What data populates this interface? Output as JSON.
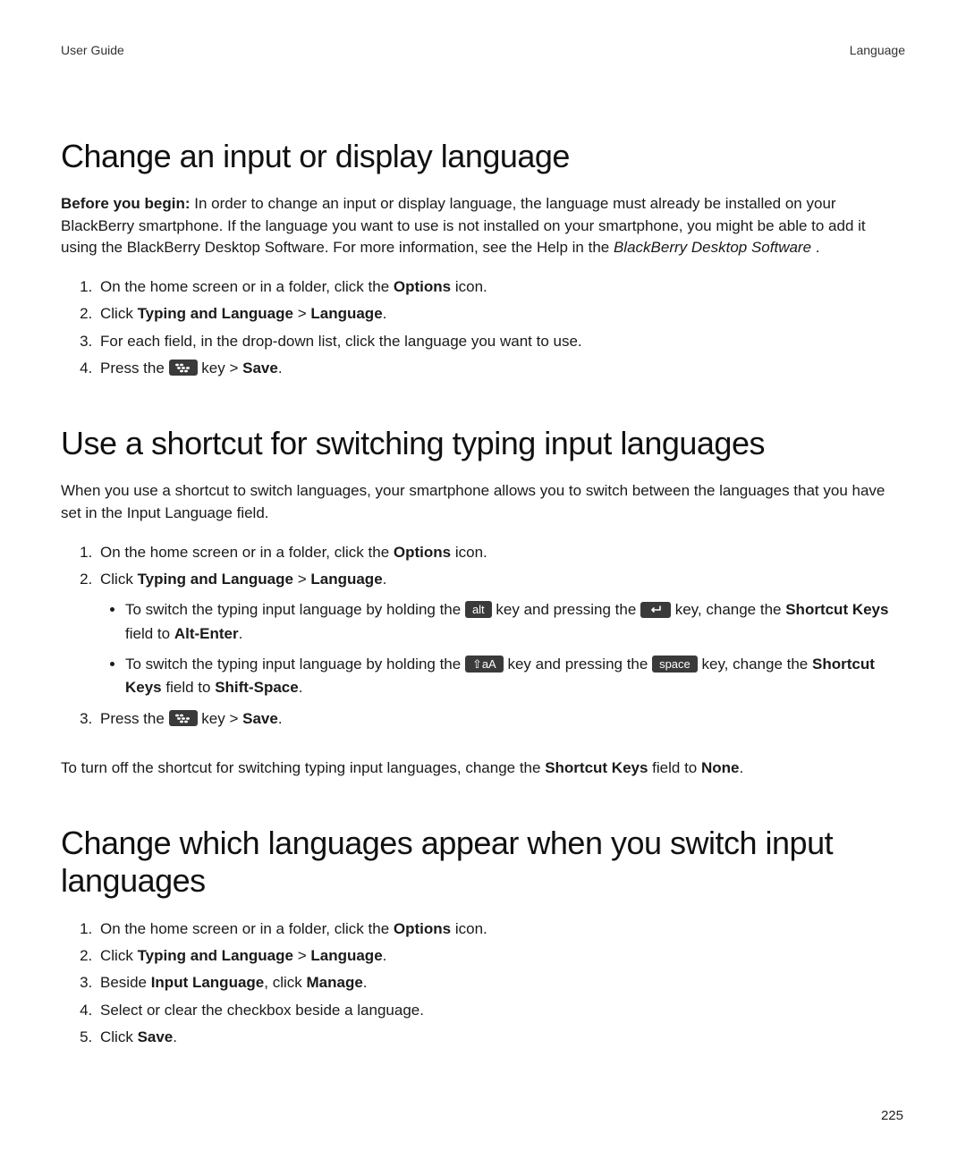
{
  "header": {
    "left": "User Guide",
    "right": "Language"
  },
  "page_number": "225",
  "section1": {
    "title": "Change an input or display language",
    "intro_bold": "Before you begin:",
    "intro_rest": " In order to change an input or display language, the language must already be installed on your BlackBerry smartphone. If the language you want to use is not installed on your smartphone, you might be able to add it using the BlackBerry Desktop Software. For more information, see the Help in the ",
    "intro_italic": "BlackBerry Desktop Software",
    "intro_end": " .",
    "step1_a": "On the home screen or in a folder, click the ",
    "step1_b": "Options",
    "step1_c": " icon.",
    "step2_a": "Click ",
    "step2_b": "Typing and Language",
    "step2_c": " > ",
    "step2_d": "Language",
    "step2_e": ".",
    "step3": "For each field, in the drop-down list, click the language you want to use.",
    "step4_a": "Press the ",
    "step4_b": " key > ",
    "step4_c": "Save",
    "step4_d": "."
  },
  "section2": {
    "title": "Use a shortcut for switching typing input languages",
    "intro": "When you use a shortcut to switch languages, your smartphone allows you to switch between the languages that you have set in the Input Language field.",
    "step1_a": "On the home screen or in a folder, click the ",
    "step1_b": "Options",
    "step1_c": " icon.",
    "step2_a": "Click ",
    "step2_b": "Typing and Language",
    "step2_c": " > ",
    "step2_d": "Language",
    "step2_e": ".",
    "b1_a": "To switch the typing input language by holding the ",
    "b1_b": " key and pressing the ",
    "b1_c": " key, change the ",
    "b1_d": "Shortcut Keys",
    "b1_e": " field to ",
    "b1_f": "Alt-Enter",
    "b1_g": ".",
    "b2_a": "To switch the typing input language by holding the ",
    "b2_b": " key and pressing the ",
    "b2_c": " key, change the ",
    "b2_d": "Shortcut Keys",
    "b2_e": " field to ",
    "b2_f": "Shift-Space",
    "b2_g": ".",
    "step3_a": "Press the ",
    "step3_b": " key > ",
    "step3_c": "Save",
    "step3_d": ".",
    "closing_a": "To turn off the shortcut for switching typing input languages, change the ",
    "closing_b": "Shortcut Keys",
    "closing_c": " field to ",
    "closing_d": "None",
    "closing_e": "."
  },
  "section3": {
    "title": "Change which languages appear when you switch input languages",
    "step1_a": "On the home screen or in a folder, click the ",
    "step1_b": "Options",
    "step1_c": " icon.",
    "step2_a": "Click ",
    "step2_b": "Typing and Language",
    "step2_c": " > ",
    "step2_d": "Language",
    "step2_e": ".",
    "step3_a": "Beside ",
    "step3_b": "Input Language",
    "step3_c": ", click ",
    "step3_d": "Manage",
    "step3_e": ".",
    "step4": "Select or clear the checkbox beside a language.",
    "step5_a": "Click ",
    "step5_b": "Save",
    "step5_c": "."
  },
  "keys": {
    "alt": "alt",
    "space": "space",
    "shift": "⇧aA"
  }
}
